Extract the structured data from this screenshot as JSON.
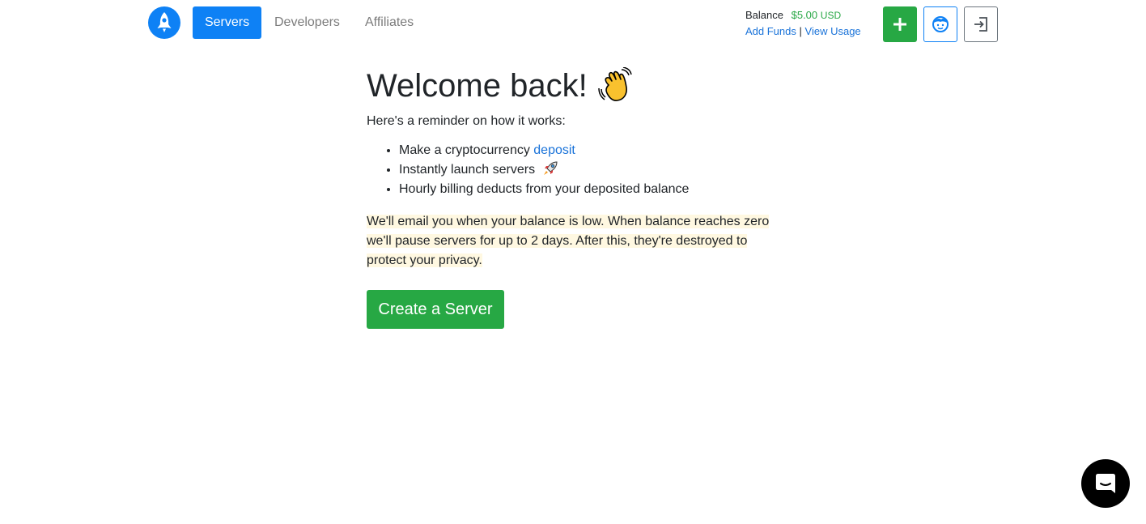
{
  "nav": {
    "tabs": [
      {
        "label": "Servers",
        "active": true
      },
      {
        "label": "Developers",
        "active": false
      },
      {
        "label": "Affiliates",
        "active": false
      }
    ]
  },
  "balance": {
    "label": "Balance",
    "amount": "$5.00",
    "currency": "USD",
    "add_funds": "Add Funds",
    "separator": "|",
    "view_usage": "View Usage"
  },
  "main": {
    "title": "Welcome back!",
    "intro": "Here's a reminder on how it works:",
    "step1_prefix": "Make a cryptocurrency ",
    "step1_link": "deposit",
    "step2": "Instantly launch servers",
    "step3": "Hourly billing deducts from your deposited balance",
    "warning": " We'll email you when your balance is low. When balance reaches zero we'll pause servers for up to 2 days. After this, they're destroyed to protect your privacy.",
    "cta": "Create a Server"
  },
  "colors": {
    "primary": "#0e81f5",
    "success": "#27a844",
    "link": "#1a73d9",
    "highlight": "#fff8e1"
  },
  "icons": [
    "rocket-logo-icon",
    "plus-icon",
    "account-face-icon",
    "logout-icon",
    "waving-hand-icon",
    "rocket-emoji-icon",
    "chat-icon"
  ]
}
